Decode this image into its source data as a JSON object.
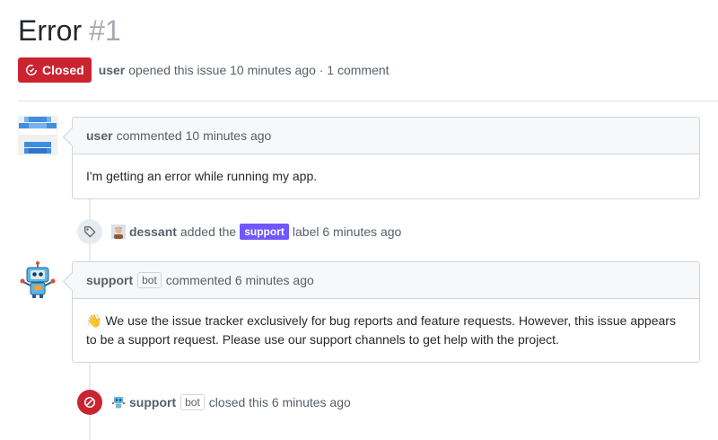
{
  "issue": {
    "title": "Error",
    "number": "#1",
    "state_label": "Closed",
    "author": "user",
    "meta_text": "opened this issue 10 minutes ago · 1 comment"
  },
  "comments": [
    {
      "author": "user",
      "meta": "commented 10 minutes ago",
      "body": "I'm getting an error while running my app."
    },
    {
      "author": "support",
      "badge": "bot",
      "meta": "commented 6 minutes ago",
      "emoji": "👋",
      "body": "We use the issue tracker exclusively for bug reports and feature requests. However, this issue appears to be a support request. Please use our support channels to get help with the project."
    }
  ],
  "events": [
    {
      "actor": "dessant",
      "action": "added the",
      "label": "support",
      "label_color": "#7057ff",
      "suffix": "label 6 minutes ago",
      "icon": "tag-icon"
    },
    {
      "actor": "support",
      "badge": "bot",
      "action": "closed this 6 minutes ago",
      "icon": "circle-slash-icon"
    }
  ],
  "colors": {
    "closed_red": "#cb2431",
    "label_purple": "#7057ff",
    "border": "#d1d5da",
    "header_bg": "#f6f8fa"
  }
}
